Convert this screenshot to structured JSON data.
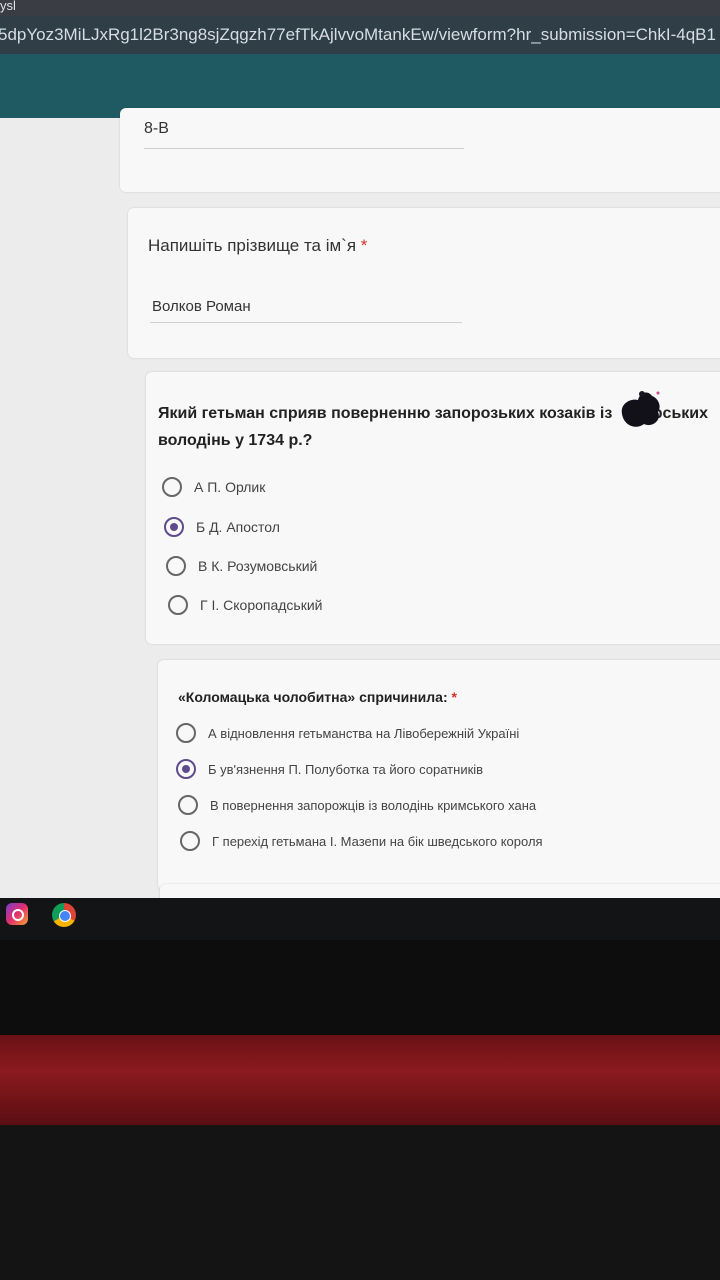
{
  "browser": {
    "tab_text": "ysl",
    "url": "5dpYoz3MiLJxRg1l2Br3ng8sjZqgzh77efTkAjlvvoMtankEw/viewform?hr_submission=ChkI-4qB1"
  },
  "form": {
    "class_answer": "8-В",
    "name_question": {
      "title": "Напишіть прізвище та ім`я",
      "required_mark": "*",
      "answer": "Волков Роман"
    },
    "question1": {
      "title_line1": "Який гетьман сприяв поверненню запорозьких козаків із",
      "title_line1_end": "рських",
      "title_line2": "володінь у 1734 р.?",
      "options": [
        {
          "label": "А П. Орлик",
          "selected": false
        },
        {
          "label": "Б Д. Апостол",
          "selected": true
        },
        {
          "label": "В К. Розумовський",
          "selected": false
        },
        {
          "label": "Г І. Скоропадський",
          "selected": false
        }
      ]
    },
    "question2": {
      "title": "«Коломацька чолобитна» спричинила:",
      "required_mark": "*",
      "options": [
        {
          "label": "А відновлення гетьманства на Лівобережній Україні",
          "selected": false
        },
        {
          "label": "Б ув'язнення П. Полуботка та його соратників",
          "selected": true
        },
        {
          "label": "В повернення запорожців із володінь кримського хана",
          "selected": false
        },
        {
          "label": "Г перехід гетьмана І. Мазепи на бік шведського короля",
          "selected": false
        }
      ]
    }
  },
  "taskbar": {
    "icons": [
      "instagram-icon",
      "chrome-icon"
    ]
  },
  "colors": {
    "selected_radio": "#5f4b8b",
    "required": "#d93025",
    "header_band": "#1f5a63"
  }
}
